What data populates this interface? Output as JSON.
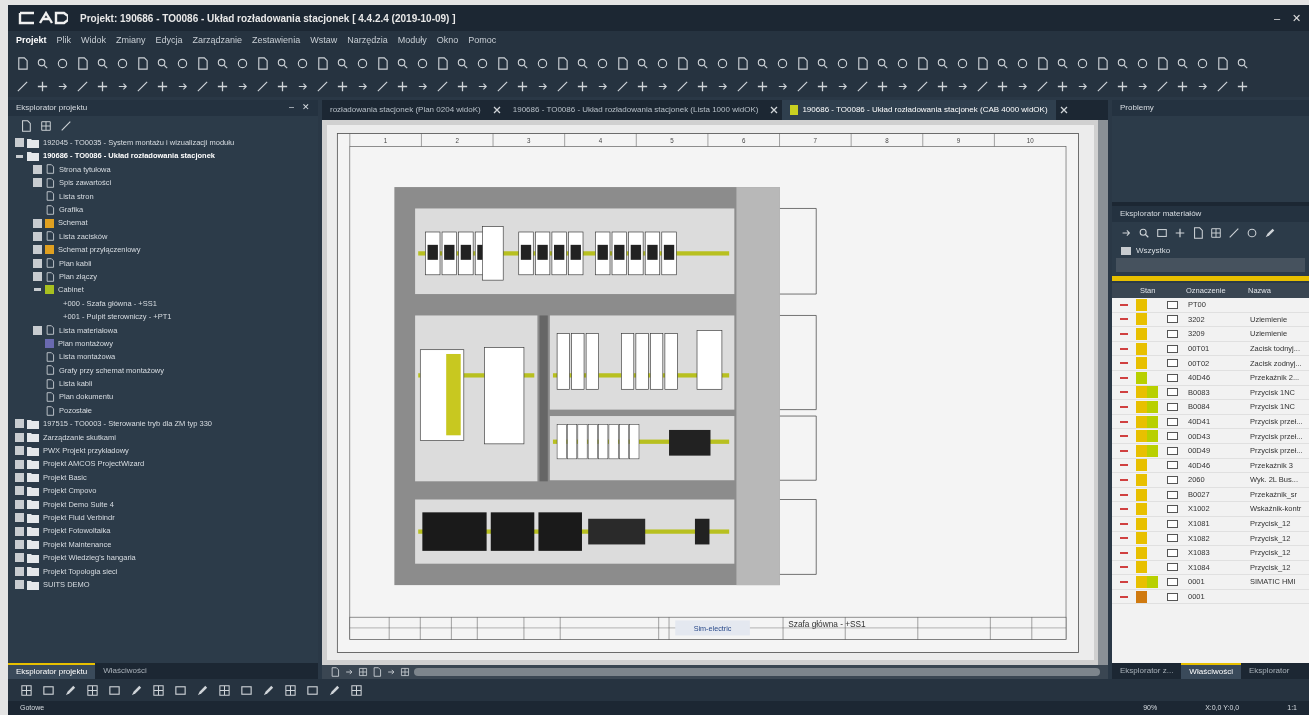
{
  "window": {
    "title": "Projekt: 190686 - TO0086 - Układ rozładowania stacjonek [ 4.4.2.4 (2019-10-09) ]",
    "controls": [
      "–",
      "✕"
    ]
  },
  "menu": [
    {
      "label": "Projekt",
      "selected": true
    },
    {
      "label": "Plik",
      "selected": false
    },
    {
      "label": "Widok",
      "selected": false
    },
    {
      "label": "Zmiany",
      "selected": false
    },
    {
      "label": "Edycja",
      "selected": false
    },
    {
      "label": "Zarządzanie",
      "selected": false
    },
    {
      "label": "Zestawienia",
      "selected": false
    },
    {
      "label": "Wstaw",
      "selected": false
    },
    {
      "label": "Narzędzia",
      "selected": false
    },
    {
      "label": "Moduły",
      "selected": false
    },
    {
      "label": "Okno",
      "selected": false
    },
    {
      "label": "Pomoc",
      "selected": false
    }
  ],
  "project_explorer": {
    "title": "Eksplorator projektu",
    "header_controls": [
      "–",
      "✕"
    ],
    "tree": [
      {
        "label": "192045 - TO0035 - System montażu i wizualizacji modułu",
        "expanded": false,
        "bold": false,
        "kind": "folder"
      },
      {
        "label": "190686 - TO0086 - Układ rozładowania stacjonek",
        "expanded": true,
        "bold": true,
        "kind": "folder",
        "children": [
          {
            "label": "Strona tytułowa",
            "expanded": false,
            "kind": "page"
          },
          {
            "label": "Spis zawartości",
            "expanded": false,
            "kind": "page"
          },
          {
            "label": "Lista stron",
            "kind": "page"
          },
          {
            "label": "Grafika",
            "kind": "page"
          },
          {
            "label": "Schemat",
            "expanded": false,
            "kind": "square",
            "color": "#e0a020"
          },
          {
            "label": "Lista zacisków",
            "expanded": false,
            "kind": "page"
          },
          {
            "label": "Schemat przyłączeniowy",
            "expanded": false,
            "kind": "square",
            "color": "#e0a020"
          },
          {
            "label": "Plan kabli",
            "expanded": false,
            "kind": "page"
          },
          {
            "label": "Plan złączy",
            "expanded": false,
            "kind": "page"
          },
          {
            "label": "Cabinet",
            "expanded": true,
            "kind": "square",
            "color": "#a8c020",
            "children": [
              {
                "label": "+000 - Szafa główna - +SS1"
              },
              {
                "label": "+001 - Pulpit sterowniczy - +PT1"
              }
            ]
          },
          {
            "label": "Lista materiałowa",
            "expanded": false,
            "kind": "page"
          },
          {
            "label": "Plan montażowy",
            "kind": "square",
            "color": "#6a6ab0"
          },
          {
            "label": "Lista montażowa",
            "kind": "page"
          },
          {
            "label": "Grafy przy schemat montażowy",
            "kind": "page"
          },
          {
            "label": "Lista kabli",
            "kind": "page"
          },
          {
            "label": "Plan dokumentu",
            "kind": "page"
          },
          {
            "label": "Pozostałe",
            "kind": "page"
          }
        ]
      },
      {
        "label": "197515 - TO0003 - Sterowanie tryb dla ZM typ 330",
        "expanded": false,
        "bold": false,
        "kind": "folder"
      },
      {
        "label": "Zarządzanie skutkami",
        "expanded": false,
        "bold": false,
        "kind": "folder"
      },
      {
        "label": "PWX Projekt przykładowy",
        "expanded": false,
        "bold": false,
        "kind": "folder"
      },
      {
        "label": "Projekt AMCOS ProjectWizard",
        "expanded": false,
        "bold": false,
        "kind": "folder"
      },
      {
        "label": "Projekt Basic",
        "expanded": false,
        "bold": false,
        "kind": "folder"
      },
      {
        "label": "Projekt Cmpovo",
        "expanded": false,
        "bold": false,
        "kind": "folder"
      },
      {
        "label": "Projekt Demo Suite 4",
        "expanded": false,
        "bold": false,
        "kind": "folder"
      },
      {
        "label": "Projekt Fluid Verbindr",
        "expanded": false,
        "bold": false,
        "kind": "folder"
      },
      {
        "label": "Projekt Fotowoltaika",
        "expanded": false,
        "bold": false,
        "kind": "folder"
      },
      {
        "label": "Projekt Maintenance",
        "expanded": false,
        "bold": false,
        "kind": "folder"
      },
      {
        "label": "Projekt Wiedzieg's hangaria",
        "expanded": false,
        "bold": false,
        "kind": "folder"
      },
      {
        "label": "Projekt Topologia sieci",
        "expanded": false,
        "bold": false,
        "kind": "folder"
      },
      {
        "label": "SUITS DEMO",
        "expanded": false,
        "bold": false,
        "kind": "folder"
      }
    ],
    "bottom_tabs": [
      {
        "label": "Eksplorator projektu",
        "selected": true
      },
      {
        "label": "Właściwości",
        "selected": false
      }
    ]
  },
  "document_tabs": [
    {
      "label": "rozładowania stacjonek (Plan 0204 widoK)",
      "selected": false
    },
    {
      "label": "190686 - TO0086 - Układ rozładowania stacjonek (Lista 1000 widOK)",
      "selected": false
    },
    {
      "label": "190686 - TO0086 - Układ rozładowania stacjonek (CAB 4000 widOK)",
      "selected": true
    }
  ],
  "drawing": {
    "columns": [
      "1",
      "2",
      "3",
      "4",
      "5",
      "6",
      "7",
      "8",
      "9",
      "10"
    ],
    "title_block": {
      "company": "Sim-electric",
      "sheet": "Szafa główna - +SS1"
    }
  },
  "problems": {
    "title": "Problemy"
  },
  "material_explorer": {
    "title": "Eksplorator materiałów",
    "filter": "Wszystko",
    "columns": [
      "Stan",
      "Oznaczenie",
      "Nazwa"
    ],
    "rows": [
      {
        "code": "PT00",
        "status": [
          {
            "color": "#e8c000"
          }
        ]
      },
      {
        "code": "3202",
        "name": "Uziemienie",
        "status": [
          {
            "color": "#e8c000"
          }
        ]
      },
      {
        "code": "3209",
        "name": "Uziemienie",
        "status": [
          {
            "color": "#e8c000"
          }
        ]
      },
      {
        "code": "00T01",
        "name": "Zacisk todnyj...",
        "status": [
          {
            "color": "#e8c000"
          }
        ]
      },
      {
        "code": "00T02",
        "name": "Zacisk zodnyj...",
        "status": [
          {
            "color": "#e8c000"
          }
        ]
      },
      {
        "code": "40D46",
        "name": "Przekaźnik 2...",
        "status": [
          {
            "color": "#b8d000"
          }
        ]
      },
      {
        "code": "B0083",
        "name": "Przycisk 1NC",
        "status": [
          {
            "color": "#e8c000"
          },
          {
            "color": "#b8d000"
          }
        ]
      },
      {
        "code": "B0084",
        "name": "Przycisk 1NC",
        "status": [
          {
            "color": "#e8c000"
          },
          {
            "color": "#b8d000"
          }
        ]
      },
      {
        "code": "40D41",
        "name": "Przycisk przeł...",
        "status": [
          {
            "color": "#e8c000"
          },
          {
            "color": "#b8d000"
          }
        ]
      },
      {
        "code": "00D43",
        "name": "Przycisk przeł...",
        "status": [
          {
            "color": "#e8c000"
          },
          {
            "color": "#b8d000"
          }
        ]
      },
      {
        "code": "00D49",
        "name": "Przycisk przeł...",
        "status": [
          {
            "color": "#e8c000"
          },
          {
            "color": "#b8d000"
          }
        ]
      },
      {
        "code": "40D46",
        "name": "Przekaźnik 3",
        "status": [
          {
            "color": "#e8c000"
          }
        ]
      },
      {
        "code": "2060",
        "name": "Wyk. 2L Bus...",
        "status": [
          {
            "color": "#e8c000"
          }
        ]
      },
      {
        "code": "B0027",
        "name": "Przekaźnik_sr",
        "status": [
          {
            "color": "#e8c000"
          }
        ]
      },
      {
        "code": "X1002",
        "name": "Wskaźnik-kontr",
        "status": [
          {
            "color": "#e8c000"
          }
        ]
      },
      {
        "code": "X1081",
        "name": "Przycisk_12",
        "status": [
          {
            "color": "#e8c000"
          }
        ]
      },
      {
        "code": "X1082",
        "name": "Przycisk_12",
        "status": [
          {
            "color": "#e8c000"
          }
        ]
      },
      {
        "code": "X1083",
        "name": "Przycisk_12",
        "status": [
          {
            "color": "#e8c000"
          }
        ]
      },
      {
        "code": "X1084",
        "name": "Przycisk_12",
        "status": [
          {
            "color": "#e8c000"
          }
        ]
      },
      {
        "code": "0001",
        "name": "SIMATIC HMI",
        "status": [
          {
            "color": "#e8c000"
          },
          {
            "color": "#b8d000"
          }
        ]
      },
      {
        "code": "0001",
        "status": [
          {
            "color": "#d07a10"
          }
        ]
      }
    ],
    "bottom_tabs": [
      {
        "label": "Eksplorator z...",
        "selected": false
      },
      {
        "label": "Właściwości",
        "selected": true
      },
      {
        "label": "Eksplorator",
        "selected": false
      }
    ]
  },
  "status_bar": {
    "left": "Gotowe",
    "zoom": "90%",
    "coords": "X:0,0 Y:0,0",
    "scale": "1:1"
  }
}
